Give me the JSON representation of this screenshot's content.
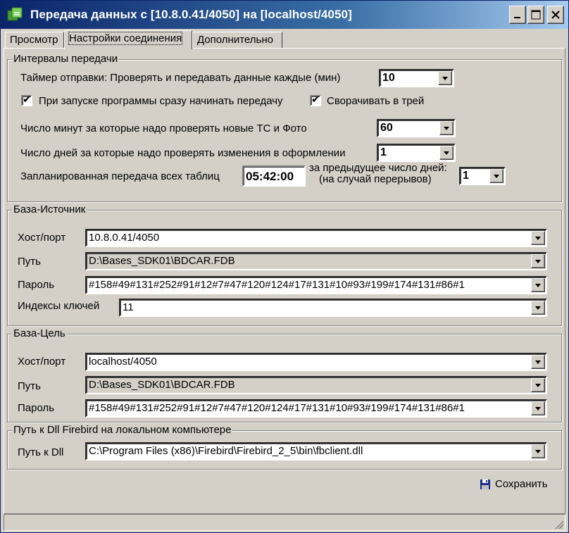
{
  "window": {
    "title": "Передача данных с [10.8.0.41/4050] на [localhost/4050]",
    "controls": {
      "minimize": "minimize-icon",
      "maximize": "maximize-icon",
      "close": "close-icon"
    }
  },
  "tabs": [
    {
      "label": "Просмотр",
      "active": false
    },
    {
      "label": "Настройки соединения",
      "active": true
    },
    {
      "label": "Дополнительно",
      "active": false
    }
  ],
  "intervals": {
    "legend": "Интервалы передачи",
    "timer_label": "Таймер отправки: Проверять и передавать данные каждые (мин)",
    "timer_value": "10",
    "start_immediately_label": "При запуске программы сразу начинать передачу",
    "start_immediately_checked": true,
    "minimize_tray_label": "Сворачивать в трей",
    "minimize_tray_checked": true,
    "minutes_label": "Число минут за которые надо проверять новые ТС и Фото",
    "minutes_value": "60",
    "days_label": "Число дней за которые надо проверять изменения в оформлении",
    "days_value": "1",
    "scheduled_label": "Запланированная передача всех таблиц",
    "scheduled_time": "05:42:00",
    "prev_days_label_1": "за предыдущее число дней:",
    "prev_days_label_2": "(на случай перерывов)",
    "prev_days_value": "1"
  },
  "source": {
    "legend": "База-Источник",
    "host_label": "Хост/порт",
    "host_value": "10.8.0.41/4050",
    "path_label": "Путь",
    "path_value": "D:\\Bases_SDK01\\BDCAR.FDB",
    "password_label": "Пароль",
    "password_value": "#158#49#131#252#91#12#7#47#120#124#17#131#10#93#199#174#131#86#1",
    "keys_label": "Индексы ключей",
    "keys_value": "11"
  },
  "target": {
    "legend": "База-Цель",
    "host_label": "Хост/порт",
    "host_value": "localhost/4050",
    "path_label": "Путь",
    "path_value": "D:\\Bases_SDK01\\BDCAR.FDB",
    "password_label": "Пароль",
    "password_value": "#158#49#131#252#91#12#7#47#120#124#17#131#10#93#199#174#131#86#1"
  },
  "dll": {
    "legend": "Путь к Dll Firebird на локальном компьютере",
    "path_label": "Путь к Dll",
    "path_value": "C:\\Program Files (x86)\\Firebird\\Firebird_2_5\\bin\\fbclient.dll"
  },
  "actions": {
    "save_label": "Сохранить",
    "save_icon": "floppy-disk-icon"
  }
}
